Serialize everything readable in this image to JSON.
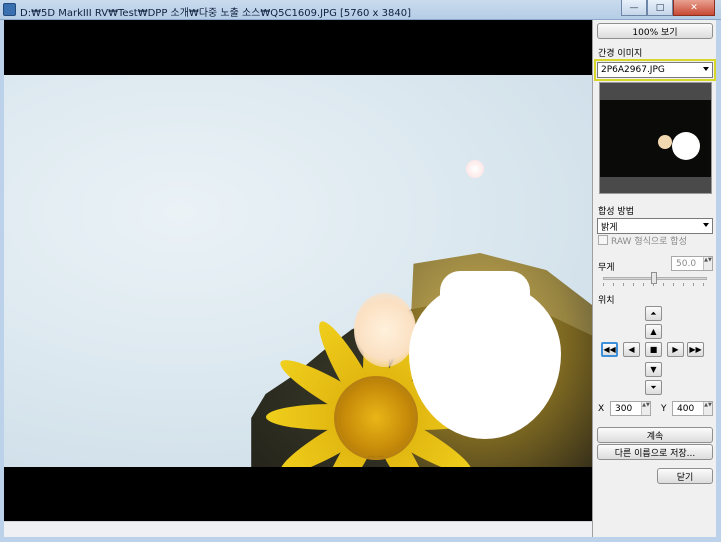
{
  "window": {
    "title": "D:₩5D MarkIII RV₩Test₩DPP 소개₩다중 노출 소스₩Q5C1609.JPG [5760 x 3840]",
    "controls": {
      "minimize": "—",
      "maximize": "□",
      "close": "✕"
    }
  },
  "panel": {
    "view_100_label": "100% 보기",
    "bg_image_label": "간경 이미지",
    "bg_image_value": "2P6A2967.JPG",
    "composite_label": "합성 방법",
    "composite_value": "밝게",
    "raw_checkbox_label": "RAW 형식으로 합성",
    "weight_label": "무게",
    "weight_value": "50.0",
    "position_label": "위치",
    "x_label": "X",
    "x_value": "300",
    "y_label": "Y",
    "y_value": "400",
    "continue_label": "계속",
    "save_as_label": "다른 이름으로 저장...",
    "close_label": "닫기"
  },
  "icons": {
    "top_end": "⏶",
    "up": "▲",
    "left_end": "◀◀",
    "left": "◀",
    "center": "■",
    "right": "▶",
    "right_end": "▶▶",
    "down": "▼",
    "bottom_end": "⏷",
    "spin": "▲▼"
  },
  "colors": {
    "highlight_outline": "#d8d629",
    "active_button_border": "#3c8fd8",
    "petal_yellow": "#f0cf1c"
  }
}
